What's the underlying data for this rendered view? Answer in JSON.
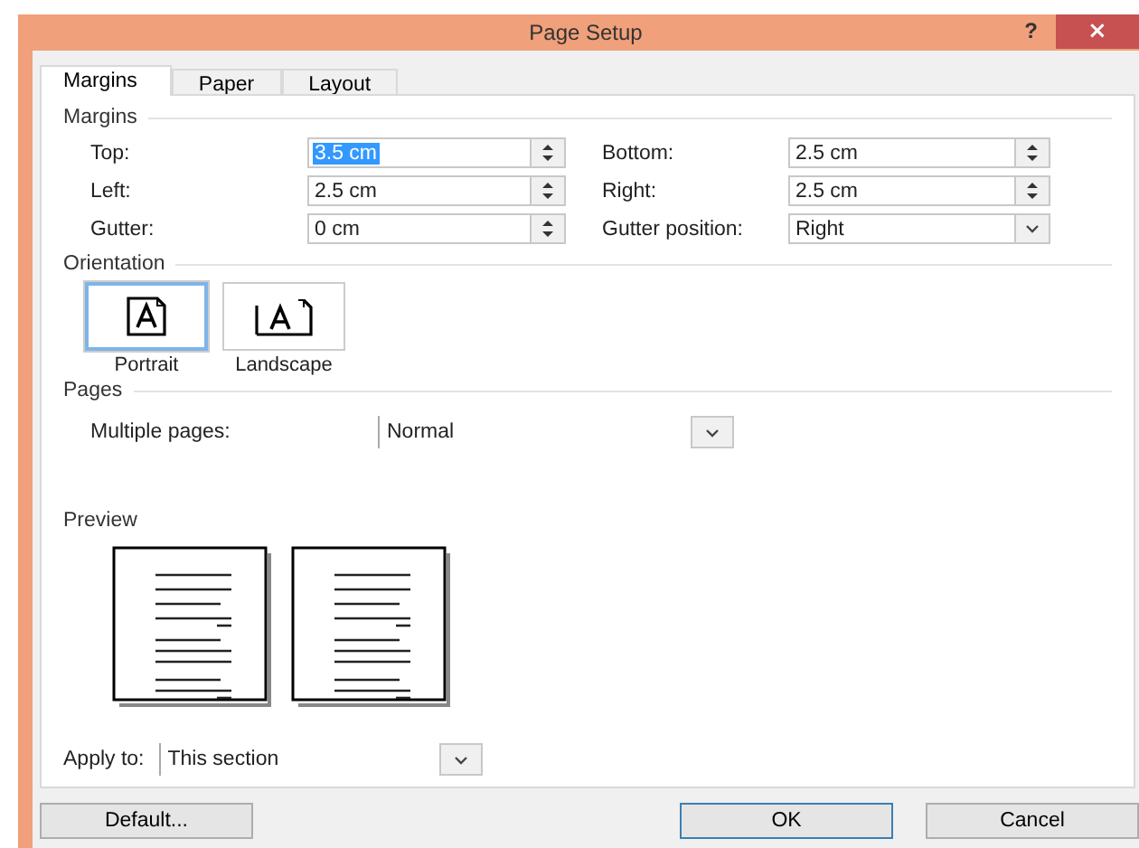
{
  "window": {
    "title": "Page Setup",
    "help": "?",
    "close": "×"
  },
  "tabs": [
    {
      "label": "Margins",
      "selected": true
    },
    {
      "label": "Paper",
      "selected": false
    },
    {
      "label": "Layout",
      "selected": false
    }
  ],
  "margins": {
    "heading": "Margins",
    "fields": [
      {
        "label": "Top:",
        "value": "3.5 cm",
        "kind": "spin",
        "selected": true
      },
      {
        "label": "Bottom:",
        "value": "2.5 cm",
        "kind": "spin",
        "selected": false
      },
      {
        "label": "Left:",
        "value": "2.5 cm",
        "kind": "spin",
        "selected": false
      },
      {
        "label": "Right:",
        "value": "2.5 cm",
        "kind": "spin",
        "selected": false
      },
      {
        "label": "Gutter:",
        "value": "0 cm",
        "kind": "spin",
        "selected": false
      },
      {
        "label": "Gutter position:",
        "value": "Right",
        "kind": "dropdown",
        "selected": false
      }
    ]
  },
  "orientation": {
    "heading": "Orientation",
    "options": [
      {
        "label": "Portrait",
        "kind": "portrait",
        "selected": true
      },
      {
        "label": "Landscape",
        "kind": "landscape",
        "selected": false
      }
    ]
  },
  "pages": {
    "heading": "Pages",
    "label": "Multiple pages:",
    "value": "Normal"
  },
  "preview": {
    "heading": "Preview"
  },
  "apply": {
    "label": "Apply to:",
    "value": "This section"
  },
  "buttons": [
    {
      "label": "Default...",
      "kind": "default"
    },
    {
      "label": "OK",
      "kind": "primary"
    },
    {
      "label": "Cancel",
      "kind": "cancel"
    }
  ]
}
